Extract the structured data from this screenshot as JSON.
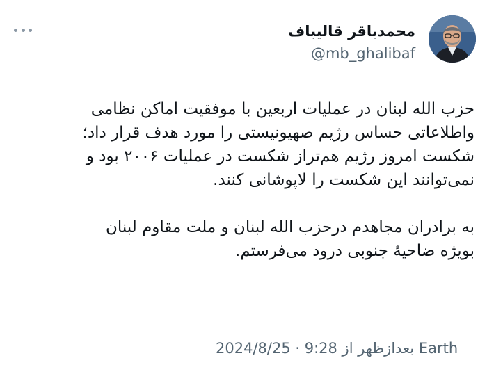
{
  "author": {
    "display_name": "محمدباقر قالیباف",
    "handle": "@mb_ghalibaf"
  },
  "tweet": {
    "paragraphs": [
      "حزب الله لبنان در عملیات اربعین با موفقیت اماکن نظامی\nواطلاعاتی حساس رژیم صهیونیستی را مورد هدف قرار داد؛\nشکست امروز رژیم هم‌تراز شکست در عملیات ۲۰۰۶ بود و\nنمی‌توانند این شکست را لاپوشانی کنند.",
      "به برادران مجاهدم درحزب الله لبنان و ملت مقاوم لبنان\nبویژه ضاحیهٔ جنوبی درود می‌فرستم."
    ],
    "meta_prefix": "2024/8/25 · 9:28 بعدازظهر از ",
    "source": "Earth"
  },
  "icons": {
    "more": "more-horizontal-icon",
    "avatar": "profile-photo"
  },
  "colors": {
    "text": "#0f1419",
    "secondary": "#536471"
  }
}
